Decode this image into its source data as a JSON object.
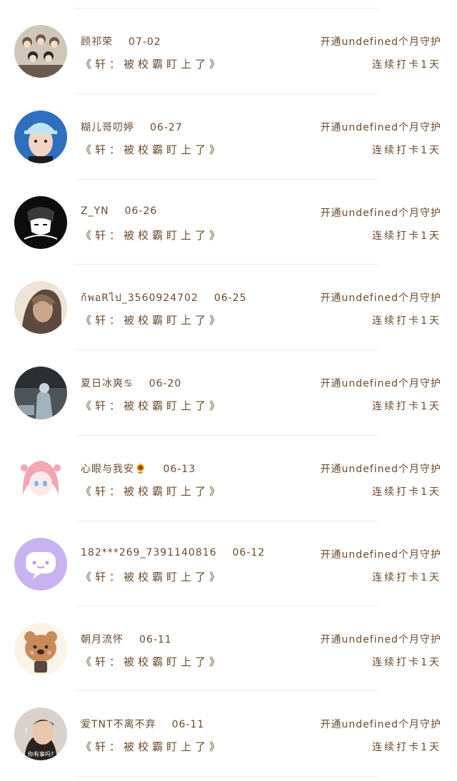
{
  "records": [
    {
      "username": "顾祁荣",
      "date": "07-02",
      "status": "开通undefined个月守护",
      "book": "《轩：被校霸盯上了》",
      "streak": "连续打卡1天",
      "avatar_icon": "group-photo-avatar",
      "avatar_colors": [
        "#cfc6b8",
        "#6a5b4f",
        "#f4dcc8",
        "#2b2a2a"
      ]
    },
    {
      "username": "糊儿哥叨婷",
      "date": "06-27",
      "status": "开通undefined个月守护",
      "book": "《轩：被校霸盯上了》",
      "streak": "连续打卡1天",
      "avatar_icon": "boy-cap-avatar",
      "avatar_colors": [
        "#2f6fbf",
        "#f2d4c2",
        "#bfe3f0",
        "#1b1b1b"
      ]
    },
    {
      "username": "Z_YN",
      "date": "06-26",
      "status": "开通undefined个月守护",
      "book": "《轩：被校霸盯上了》",
      "streak": "连续打卡1天",
      "avatar_icon": "sketch-girl-avatar",
      "avatar_colors": [
        "#0d0d0d",
        "#ffffff",
        "#3a3a3a",
        "#ffffff"
      ]
    },
    {
      "username": "ก้พอRไป_3560924702",
      "date": "06-25",
      "status": "开通undefined个月守护",
      "book": "《轩：被校霸盯上了》",
      "streak": "连续打卡1天",
      "avatar_icon": "girl-hair-avatar",
      "avatar_colors": [
        "#5c4a3e",
        "#c8a78a",
        "#efe2d6",
        "#8b6a52"
      ]
    },
    {
      "username": "夏日冰爽♋",
      "date": "06-20",
      "status": "开通undefined个月守护",
      "book": "《轩：被校霸盯上了》",
      "streak": "连续打卡1天",
      "avatar_icon": "street-photo-avatar",
      "avatar_colors": [
        "#4e5559",
        "#9fb4bd",
        "#c9d6dc",
        "#2c2f31"
      ]
    },
    {
      "username": "心眼与我安🌻",
      "date": "06-13",
      "status": "开通undefined个月守护",
      "book": "《轩：被校霸盯上了》",
      "streak": "连续打卡1天",
      "avatar_icon": "anime-girl-avatar",
      "avatar_colors": [
        "#f2a7b4",
        "#fde9ec",
        "#ffffff",
        "#7bb7e4"
      ]
    },
    {
      "username": "182***269_7391140816",
      "date": "06-12",
      "status": "开通undefined个月守护",
      "book": "《轩：被校霸盯上了》",
      "streak": "连续打卡1天",
      "avatar_icon": "chat-bubble-avatar",
      "avatar_colors": [
        "#c8b3f0",
        "#ffffff",
        "#b59be8",
        "#c8b3f0"
      ]
    },
    {
      "username": "朝月流怀",
      "date": "06-11",
      "status": "开通undefined个月守护",
      "book": "《轩：被校霸盯上了》",
      "streak": "连续打卡1天",
      "avatar_icon": "bear-avatar",
      "avatar_colors": [
        "#fbf3e8",
        "#c98a5a",
        "#3a2a20",
        "#e9a6a0"
      ]
    },
    {
      "username": "爱TNT不离不弃",
      "date": "06-11",
      "status": "开通undefined个月守护",
      "book": "《轩：被校霸盯上了》",
      "streak": "连续打卡1天",
      "avatar_icon": "boy-photo-avatar",
      "avatar_colors": [
        "#ffffff",
        "#2c2320",
        "#e7c7ae",
        "#d9d2cc"
      ],
      "avatar_caption": "你有事吗?",
      "avatar_mark": "?"
    }
  ]
}
